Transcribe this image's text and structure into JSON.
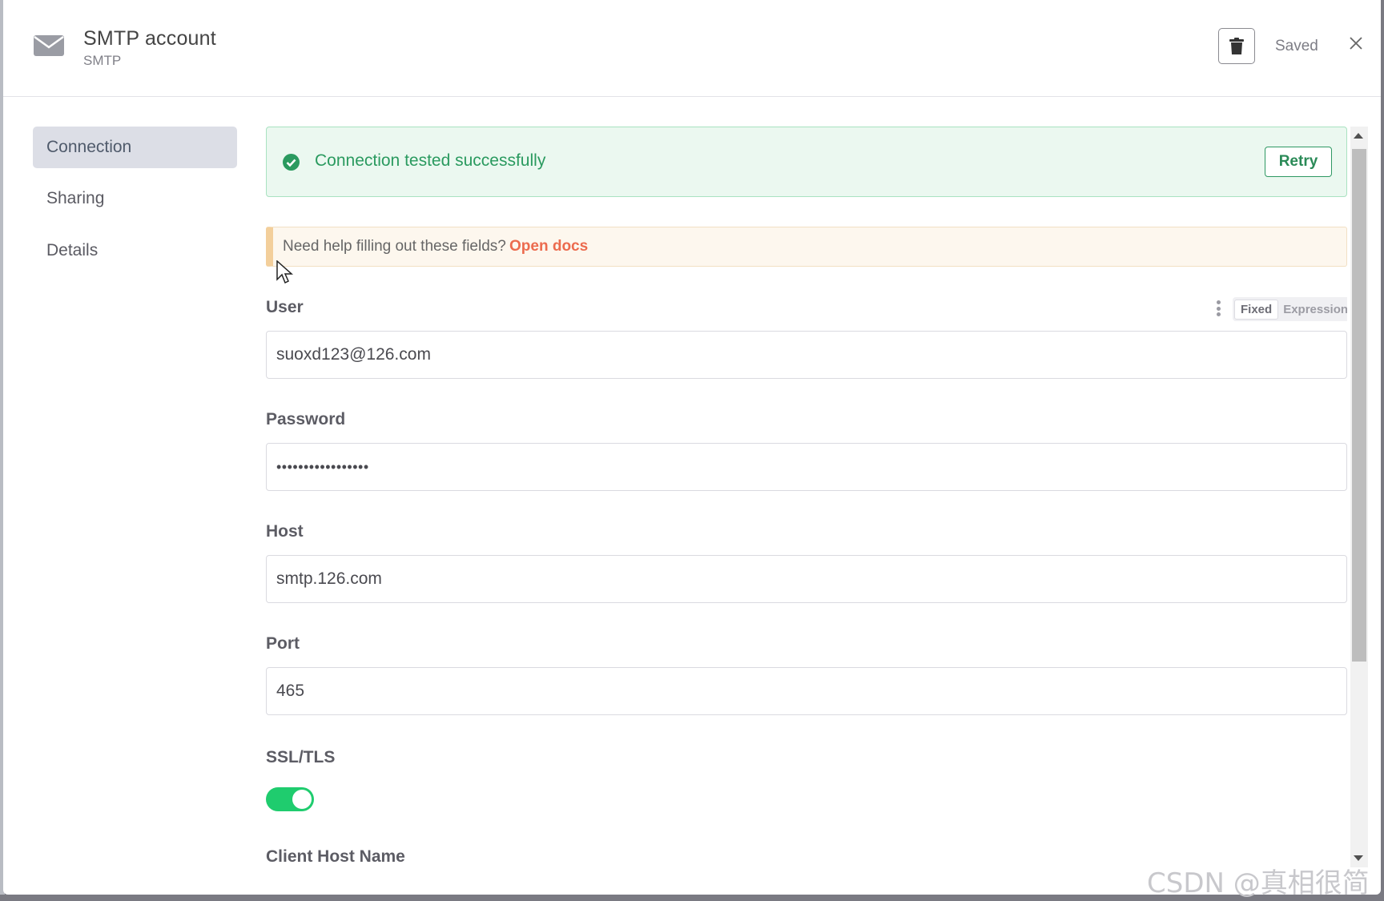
{
  "header": {
    "title": "SMTP account",
    "subtitle": "SMTP",
    "saved_label": "Saved"
  },
  "sidebar": {
    "items": [
      {
        "label": "Connection",
        "active": true
      },
      {
        "label": "Sharing",
        "active": false
      },
      {
        "label": "Details",
        "active": false
      }
    ]
  },
  "banner": {
    "success_text": "Connection tested successfully",
    "retry_label": "Retry"
  },
  "help": {
    "text": "Need help filling out these fields?",
    "link": "Open docs"
  },
  "fields": {
    "user": {
      "label": "User",
      "value": "suoxd123@126.com"
    },
    "password": {
      "label": "Password",
      "value": "•••••••••••••••••"
    },
    "host": {
      "label": "Host",
      "value": "smtp.126.com"
    },
    "port": {
      "label": "Port",
      "value": "465"
    },
    "ssl": {
      "label": "SSL/TLS",
      "enabled": true
    },
    "client_host": {
      "label": "Client Host Name"
    }
  },
  "mode_toggle": {
    "fixed": "Fixed",
    "expression": "Expression"
  },
  "watermark": "CSDN @真相很简单",
  "colors": {
    "success": "#2a9a5f",
    "link": "#ec6b4e",
    "toggle_on": "#1fcc6e",
    "active_nav": "#dcdee6"
  }
}
